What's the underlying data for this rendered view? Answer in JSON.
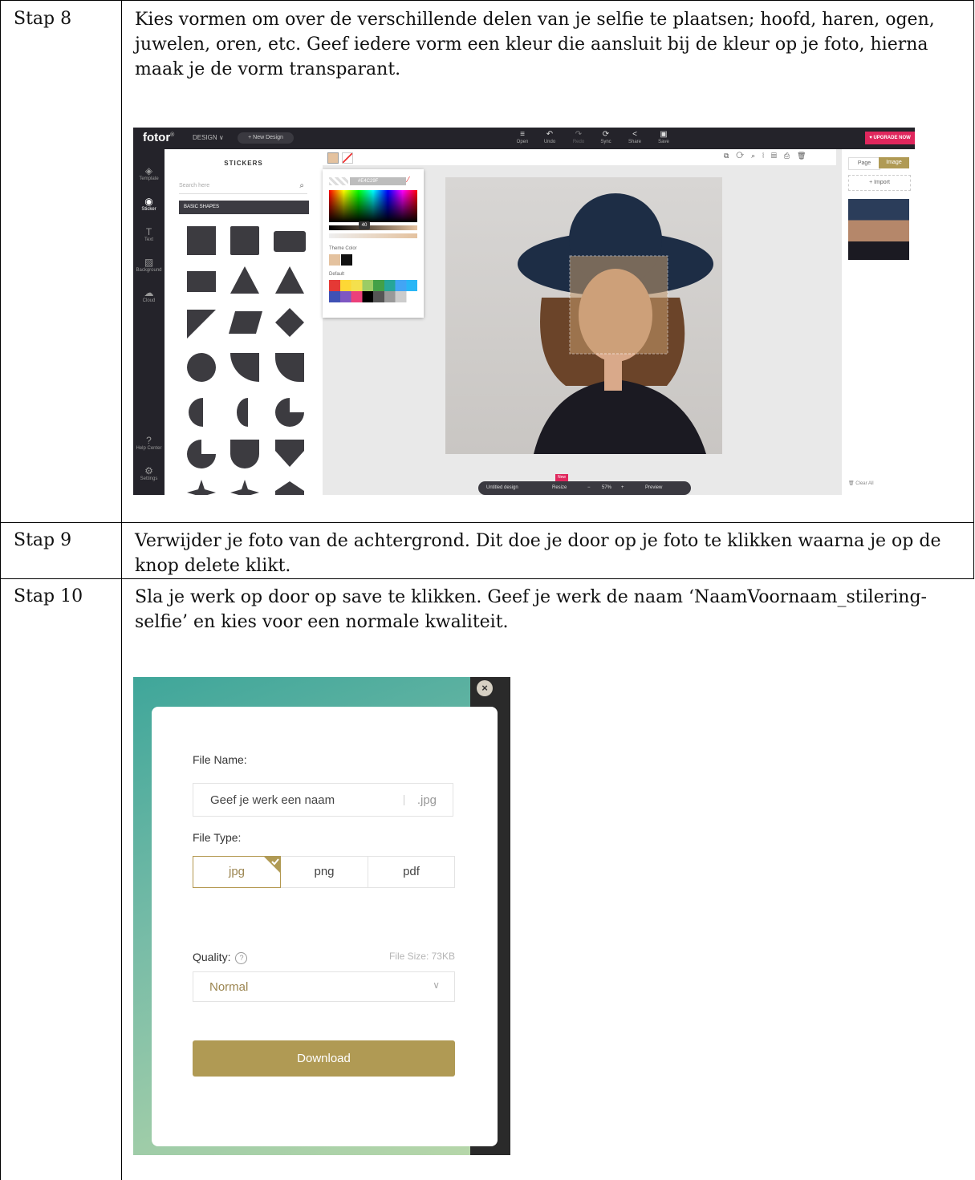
{
  "rows": [
    {
      "label": "Stap 8",
      "text": "Kies vormen om over de verschillende delen van je selfie te plaatsen; hoofd, haren, ogen, juwelen, oren, etc. Geef iedere vorm een kleur die aansluit bij de kleur op je foto, hierna maak je de vorm transparant."
    },
    {
      "label": "Stap 9",
      "text": "Verwijder je foto van de achtergrond. Dit doe je door op je foto te klikken waarna je op de knop delete klikt."
    },
    {
      "label": "Stap 10",
      "text": "Sla je werk op door op save te klikken. Geef je werk de naam ‘NaamVoornaam_stilering-selfie’ en kies voor een normale kwaliteit."
    }
  ],
  "fotor": {
    "logo": "fotor",
    "logo_mark": "®",
    "design_menu": "DESIGN ∨",
    "new_design": "+ New Design",
    "tools": [
      {
        "icon": "≡",
        "label": "Open"
      },
      {
        "icon": "↶",
        "label": "Undo"
      },
      {
        "icon": "↷",
        "label": "Redo"
      },
      {
        "icon": "⟳",
        "label": "Sync"
      },
      {
        "icon": "<",
        "label": "Share"
      },
      {
        "icon": "▣",
        "label": "Save"
      }
    ],
    "upgrade": "♥ UPGRADE NOW",
    "sidebar": [
      {
        "icon": "◈",
        "label": "Template"
      },
      {
        "icon": "◉",
        "label": "Sticker"
      },
      {
        "icon": "T",
        "label": "Text"
      },
      {
        "icon": "▨",
        "label": "Background"
      },
      {
        "icon": "☁",
        "label": "Cloud"
      },
      {
        "icon": "?",
        "label": "Help Center"
      },
      {
        "icon": "⚙",
        "label": "Settings"
      }
    ],
    "panel_title": "STICKERS",
    "search_placeholder": "Search here",
    "basic_shapes": "BASIC SHAPES",
    "color_hex": "#E4C29F",
    "opacity": "40",
    "theme_color": "Theme Color",
    "default": "Default",
    "tab_page": "Page",
    "tab_image": "Image",
    "import": "+ Import",
    "clear_all": "Clear All",
    "untitled": "Untitled design",
    "resize": "Resize",
    "new_badge": "New",
    "zoom_minus": "−",
    "zoom": "57%",
    "zoom_plus": "+",
    "preview": "Preview"
  },
  "save_dialog": {
    "file_name_label": "File Name:",
    "file_name_value": "Geef je werk een naam",
    "extension": ".jpg",
    "file_type_label": "File Type:",
    "types": [
      "jpg",
      "png",
      "pdf"
    ],
    "quality_label": "Quality:",
    "help": "?",
    "file_size": "File Size: 73KB",
    "quality_value": "Normal",
    "download": "Download",
    "close": "×"
  }
}
